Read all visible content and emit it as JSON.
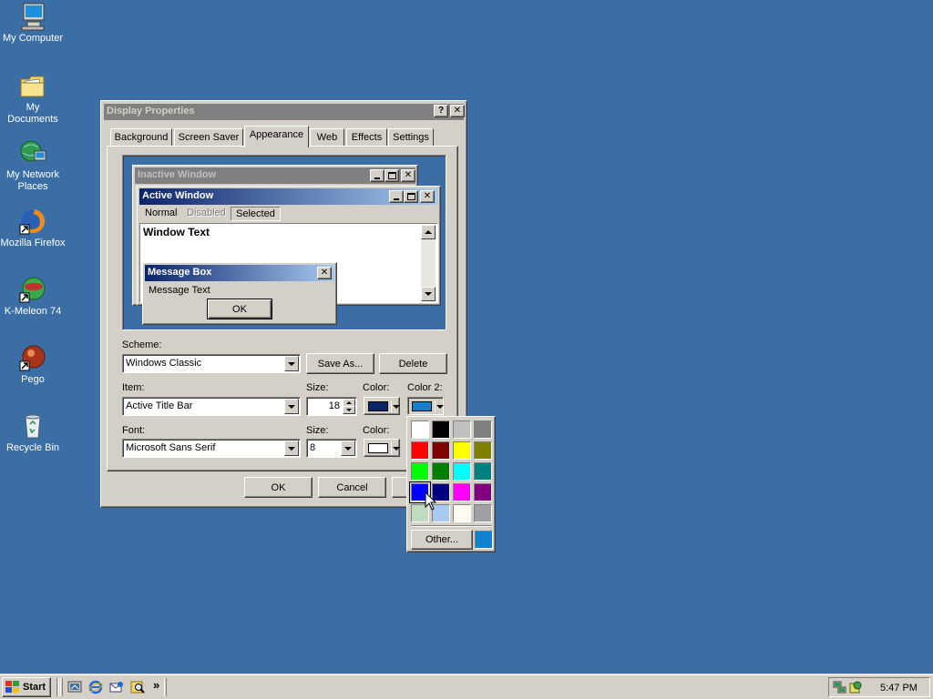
{
  "desktop": {
    "icons": [
      {
        "label": "My Computer"
      },
      {
        "label": "My Documents"
      },
      {
        "label": "My Network Places"
      },
      {
        "label": "Mozilla Firefox"
      },
      {
        "label": "K-Meleon 74"
      },
      {
        "label": "Pego"
      },
      {
        "label": "Recycle Bin"
      }
    ]
  },
  "dialog": {
    "title": "Display Properties",
    "tabs": [
      "Background",
      "Screen Saver",
      "Appearance",
      "Web",
      "Effects",
      "Settings"
    ],
    "preview": {
      "inactive_title": "Inactive Window",
      "active_title": "Active Window",
      "menu": [
        "Normal",
        "Disabled",
        "Selected"
      ],
      "window_text": "Window Text",
      "msgbox_title": "Message Box",
      "msgbox_text": "Message Text",
      "msgbox_ok": "OK"
    },
    "scheme": {
      "label": "Scheme:",
      "value": "Windows Classic",
      "save_as": "Save As...",
      "delete": "Delete"
    },
    "item": {
      "label": "Item:",
      "value": "Active Title Bar",
      "size_label": "Size:",
      "size_value": "18",
      "color_label": "Color:",
      "color": "#0a246a",
      "color2_label": "Color 2:",
      "color2": "#1082d0"
    },
    "font": {
      "label": "Font:",
      "value": "Microsoft Sans Serif",
      "size_label": "Size:",
      "size_value": "8",
      "color_label": "Color:",
      "color": "#ffffff"
    },
    "buttons": {
      "ok": "OK",
      "cancel": "Cancel"
    }
  },
  "palette": {
    "colors": [
      "#ffffff",
      "#000000",
      "#c0c0c0",
      "#808080",
      "#ff0000",
      "#800000",
      "#ffff00",
      "#808000",
      "#00ff00",
      "#008000",
      "#00ffff",
      "#008080",
      "#0000ff",
      "#000080",
      "#ff00ff",
      "#800080",
      "#c0dcc0",
      "#a6caf0",
      "#fffbf0",
      "#a0a0a4"
    ],
    "selected_index": 12,
    "other_label": "Other...",
    "custom_color": "#1082d0"
  },
  "taskbar": {
    "start_label": "Start",
    "overflow": "»",
    "clock": "5:47 PM"
  }
}
